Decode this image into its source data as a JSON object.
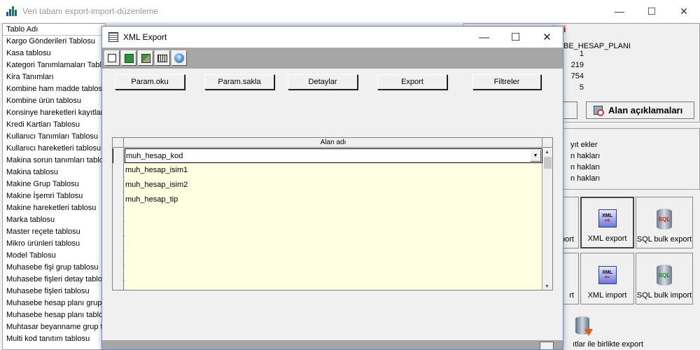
{
  "main_window": {
    "title": "Veri tabanı export-import-düzenleme",
    "controls": [
      "—",
      "☐",
      "✕"
    ]
  },
  "left_list": {
    "header": "Tablo Adı",
    "items": [
      "Kargo Gönderileri Tablosu",
      "Kasa tablosu",
      "Kategori Tanımlamaları Tablosu",
      "Kira Tanımları",
      "Kombine ham madde tablosu",
      "Kombine ürün tablosu",
      "Konsinye hareketleri kayıtları",
      "Kredi Kartları Tablosu",
      "Kullanıcı Tanımları Tablosu",
      "Kullanıcı hareketleri tablosu",
      "Makina sorun tanımları tablosu",
      "Makina tablosu",
      "Makine Grup Tablosu",
      "Makine İşemri Tablosu",
      "Makine hareketleri tablosu",
      "Marka tablosu",
      "Master reçete tablosu",
      "Mikro ürünleri tablosu",
      "Model Tablosu",
      "Muhasebe fişi grup tablosu",
      "Muhasebe fişleri detay tablosu",
      "Muhasebe fişleri tablosu",
      "Muhasebe hesap planı grup tablosu",
      "Muhasebe hesap planı tablosu",
      "Muhtasar beyanname grup tablosu",
      "Multi kod tanıtım tablosu"
    ]
  },
  "right_panel": {
    "red_heading": "leri",
    "table_name": "BE_HESAP_PLANI",
    "values": [
      "1",
      "219",
      "754",
      "5"
    ],
    "alan_button": "Alan açıklamaları",
    "lines": [
      "yıt ekler",
      "n hakları",
      "n hakları",
      "n hakları"
    ],
    "buttons": {
      "export_partial": "port",
      "xml_export": "XML export",
      "sql_bulk_export": "SQL bulk export",
      "import_partial": "rt",
      "xml_import": "XML import",
      "sql_bulk_import": "SQL bulk import",
      "bulk_with_fields": "ıtlar ile birlikte export"
    }
  },
  "dialog": {
    "title": "XML Export",
    "controls": [
      "—",
      "☐",
      "✕"
    ],
    "toolbar_icons": [
      "open-file-icon",
      "excel-icon",
      "export-icon",
      "calculator-icon",
      "help-icon"
    ],
    "buttons": {
      "param_oku": "Param.oku",
      "param_sakla": "Param.sakla",
      "detaylar": "Detaylar",
      "export": "Export",
      "filtreler": "Filtreler"
    },
    "grid": {
      "column": "Alan adı",
      "rows": [
        "muh_hesap_kod",
        "muh_hesap_isim1",
        "muh_hesap_isim2",
        "muh_hesap_tip",
        "",
        "",
        "",
        "",
        "",
        ""
      ]
    }
  }
}
